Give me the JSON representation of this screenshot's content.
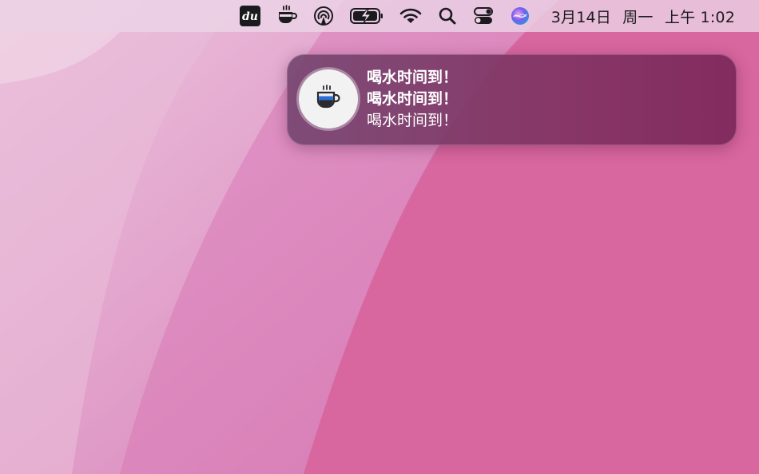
{
  "menubar": {
    "items": [
      {
        "icon": "du-app-icon"
      },
      {
        "icon": "coffee-cup-icon"
      },
      {
        "icon": "airdrop-icon"
      },
      {
        "icon": "battery-charging-icon"
      },
      {
        "icon": "wifi-icon"
      },
      {
        "icon": "spotlight-search-icon"
      },
      {
        "icon": "control-center-icon"
      },
      {
        "icon": "siri-icon"
      }
    ],
    "du_label": "du",
    "clock": {
      "date": "3月14日",
      "weekday": "周一",
      "time": "上午 1:02"
    }
  },
  "notification": {
    "app_icon": "water-cup-icon",
    "title": "喝水时间到！",
    "subtitle": "喝水时间到！",
    "body": "喝水时间到！"
  },
  "colors": {
    "menubar": "#ecd6e8",
    "wallpaper_light": "#e8b6d6",
    "wallpaper_dark": "#d86aa6",
    "notification_bg": "#7e3a6c",
    "cup_blue": "#2a6fd6"
  }
}
